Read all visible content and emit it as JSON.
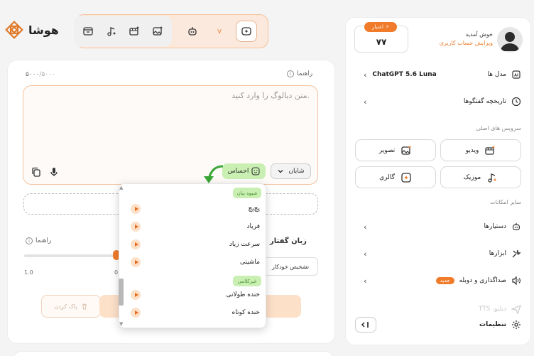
{
  "brand": {
    "name": "هوشا",
    "logo_icon": "knot-logo-icon",
    "accent": "#f07b2a"
  },
  "toolbar": {
    "icons": [
      "folder-icon",
      "music-sparkle-icon",
      "video-sparkle-icon",
      "image-sparkle-icon",
      "robot-icon",
      "chat-sparkle-icon"
    ],
    "tiny_label": "V"
  },
  "editor": {
    "counter_current": "۵۰۰۰",
    "counter_max": "/۵۰۰۰",
    "guide_label": "راهنما",
    "placeholder": "متن دیالوگ را وارد کنید.",
    "emotion_label": "احساس",
    "voice_label": "شایان"
  },
  "controls": {
    "slider_guide": "راهنما",
    "slider_min": "1.0",
    "slider_value_text": "0.",
    "speech_language_label": "زبان گفتار",
    "language_value": "تشخیص خودکار",
    "clear_label": "پاک کردن"
  },
  "emotion_dropdown": {
    "categories": [
      {
        "name": "شیوه بیان",
        "items": [
          "پچ‌پچ",
          "فریاد",
          "سرعت زیاد",
          "ماشینی"
        ]
      },
      {
        "name": "غیرکلامی",
        "items": [
          "خنده طولانی",
          "خنده کوتاه"
        ]
      }
    ]
  },
  "sidebar": {
    "welcome": "خوش آمدید",
    "edit_account": "ویرایش حساب کاربری",
    "credit_label": "اعتبار",
    "credit_value": "۷۷",
    "model_label": "مدل ها",
    "model_value": "ChatGPT 5.6 Luna",
    "history_label": "تاریخچه گفتگوها",
    "main_services_heading": "سرویس های اصلی",
    "services": [
      "ویدیو",
      "تصویر",
      "موزیک",
      "گالری"
    ],
    "other_heading": "سایر امکانات",
    "assistants_label": "دستیارها",
    "tools_label": "ابزارها",
    "dubbing_label": "صداگذاری و دوبله",
    "new_badge": "جدید",
    "faded_item": "TTS ،دبلیو",
    "settings_label": "تنظیمات"
  }
}
